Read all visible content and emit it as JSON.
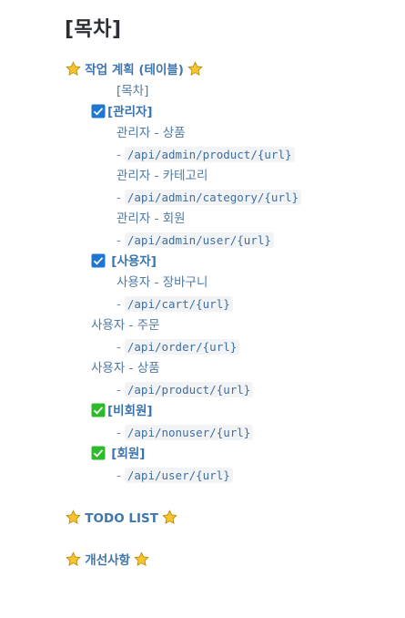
{
  "page": {
    "title": "[목차]"
  },
  "sections": {
    "work_plan": "작업 계획 (테이블)",
    "todo": "TODO LIST",
    "improvements": "개선사항"
  },
  "toc": {
    "toc_link": "[목차]",
    "admin_heading": "[관리자]",
    "admin_product_label": "관리자 - 상품",
    "admin_product_path": "/api/admin/product/{url}",
    "admin_category_label": "관리자 - 카테고리",
    "admin_category_path": "/api/admin/category/{url}",
    "admin_member_label": "관리자 - 회원",
    "admin_member_path": "/api/admin/user/{url}",
    "user_heading": "[사용자]",
    "user_cart_label": "사용자 - 장바구니",
    "user_cart_path": "/api/cart/{url}",
    "user_order_label": "사용자 - 주문",
    "user_order_path": "/api/order/{url}",
    "user_product_label": "사용자 - 상품",
    "user_product_path": "/api/product/{url}",
    "nonmember_heading": "[비회원]",
    "nonmember_path": "/api/nonuser/{url}",
    "member_heading": "[회원]",
    "member_path": "/api/user/{url}",
    "dash": "-"
  },
  "colors": {
    "star": "#f7c52b",
    "blue_check": "#1f76d2",
    "green_check": "#2dbb2d"
  }
}
